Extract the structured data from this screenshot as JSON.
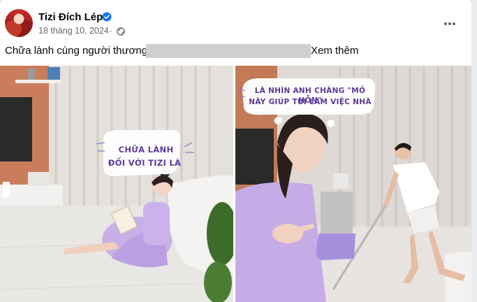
{
  "post": {
    "author": "Tizi Đích Lép",
    "date": "18 tháng 10, 2024",
    "separator": "·",
    "caption": "Chữa lành cùng người thương",
    "see_more": "Xem thêm"
  },
  "photos": {
    "left": {
      "bubble_line1": "CHỮA LÀNH",
      "bubble_line2": "ĐỐI VỚI TIZI LÀ"
    },
    "right": {
      "bubble_line1": "LÀ NHÌN ANH CHÀNG \"MỎ HỖN\"",
      "bubble_line2": "NÀY GIÚP TUI LÀM VIỆC NHÀ"
    }
  },
  "icons": [
    "verified-badge-icon",
    "globe-icon",
    "more-options-icon"
  ],
  "colors": {
    "verified": "#1877f2",
    "meta": "#65676b",
    "text": "#050505",
    "bubble_text": "#5a3a9a"
  }
}
